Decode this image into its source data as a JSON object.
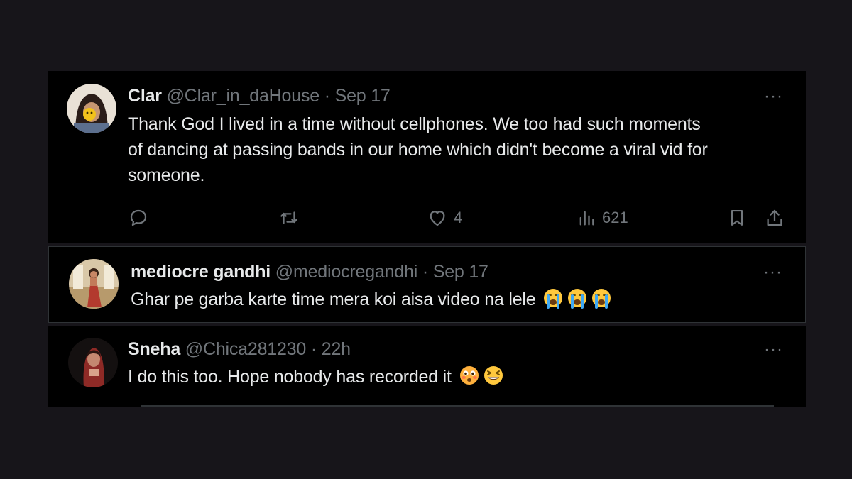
{
  "tweets": [
    {
      "name": "Clar",
      "handle": "@Clar_in_daHouse",
      "separator": "·",
      "date": "Sep 17",
      "lines": [
        "Thank God I lived in a time without cellphones. We too had such moments",
        "of dancing at passing bands in our home which didn't become a viral vid for",
        "someone."
      ],
      "more_label": "···",
      "actions": {
        "reply_icon": "reply-icon",
        "retweet_icon": "retweet-icon",
        "like_icon": "heart-icon",
        "like_count": "4",
        "views_icon": "views-icon",
        "views_count": "621",
        "bookmark_icon": "bookmark-icon",
        "share_icon": "share-icon"
      }
    },
    {
      "name": "mediocre gandhi",
      "handle": "@mediocregandhi",
      "separator": "·",
      "date": "Sep 17",
      "text": "Ghar pe garba karte time mera koi aisa video na lele",
      "emoji": [
        "loudly-crying-face",
        "loudly-crying-face",
        "loudly-crying-face"
      ],
      "more_label": "···"
    },
    {
      "name": "Sneha",
      "handle": "@Chica281230",
      "separator": "·",
      "date": "22h",
      "text": "I do this too. Hope nobody has recorded it",
      "emoji": [
        "flushed-face",
        "grinning-squinting-face"
      ],
      "more_label": "···"
    }
  ],
  "colors": {
    "background": "#17151a",
    "panel": "#000000",
    "text": "#e7e9ea",
    "muted": "#71767b",
    "border": "#2f3336"
  }
}
